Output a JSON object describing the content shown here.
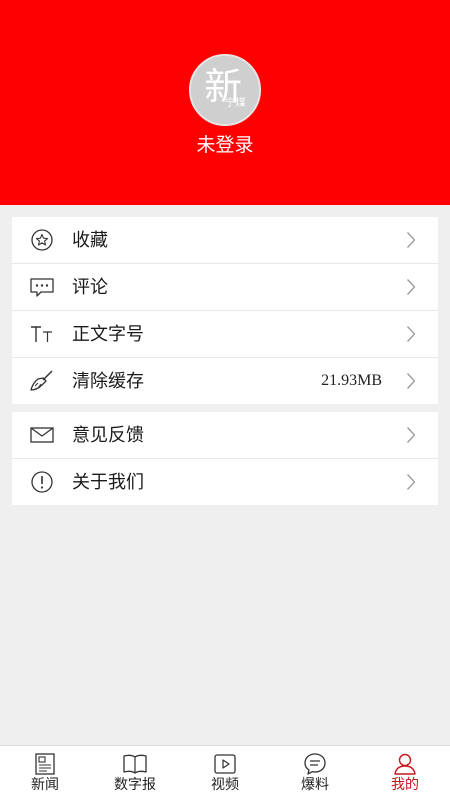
{
  "profile": {
    "logo_text": "新",
    "logo_subtext": "宁煤",
    "login_status": "未登录"
  },
  "menu_group_1": [
    {
      "label": "收藏",
      "icon": "star-icon"
    },
    {
      "label": "评论",
      "icon": "comment-icon"
    },
    {
      "label": "正文字号",
      "icon": "font-size-icon"
    },
    {
      "label": "清除缓存",
      "icon": "broom-icon",
      "value": "21.93MB"
    }
  ],
  "menu_group_2": [
    {
      "label": "意见反馈",
      "icon": "mail-icon"
    },
    {
      "label": "关于我们",
      "icon": "info-icon"
    }
  ],
  "tabbar": {
    "tabs": [
      {
        "label": "新闻",
        "icon": "news-icon"
      },
      {
        "label": "数字报",
        "icon": "book-icon"
      },
      {
        "label": "视频",
        "icon": "video-icon"
      },
      {
        "label": "爆料",
        "icon": "chat-icon"
      },
      {
        "label": "我的",
        "icon": "user-icon",
        "active": true
      }
    ]
  },
  "colors": {
    "header_bg": "#ff0000",
    "active_tab": "#c8161d",
    "page_bg": "#efefef"
  }
}
